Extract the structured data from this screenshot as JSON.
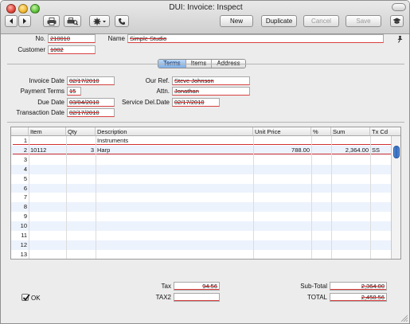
{
  "window": {
    "title": "DUI: Invoice: Inspect"
  },
  "toolbar": {
    "new_label": "New",
    "duplicate_label": "Duplicate",
    "cancel_label": "Cancel",
    "save_label": "Save"
  },
  "header": {
    "no_label": "No.",
    "no_value": "210010",
    "name_label": "Name",
    "name_value": "Simple Studio",
    "customer_label": "Customer",
    "customer_value": "1002"
  },
  "tabs": [
    {
      "label": "Terms",
      "active": true
    },
    {
      "label": "Items",
      "active": false
    },
    {
      "label": "Address",
      "active": false
    }
  ],
  "terms": {
    "invoice_date_label": "Invoice Date",
    "invoice_date": "02/17/2010",
    "payment_terms_label": "Payment Terms",
    "payment_terms": "15",
    "due_date_label": "Due Date",
    "due_date": "03/04/2010",
    "transaction_date_label": "Transaction Date",
    "transaction_date": "02/17/2010",
    "our_ref_label": "Our Ref.",
    "our_ref": "Steve Johnson",
    "attn_label": "Attn.",
    "attn": "Jonathan",
    "service_del_date_label": "Service Del.Date",
    "service_del_date": "02/17/2010"
  },
  "grid": {
    "columns": [
      "Item",
      "Qty",
      "Description",
      "Unit Price",
      "%",
      "Sum",
      "Tx Cd"
    ],
    "rows": [
      {
        "n": "1",
        "item": "",
        "qty": "",
        "desc": "Instruments",
        "price": "",
        "pct": "",
        "sum": "",
        "tx": ""
      },
      {
        "n": "2",
        "item": "10112",
        "qty": "3",
        "desc": "Harp",
        "price": "788.00",
        "pct": "",
        "sum": "2,364.00",
        "tx": "SS"
      },
      {
        "n": "3"
      },
      {
        "n": "4"
      },
      {
        "n": "5"
      },
      {
        "n": "6"
      },
      {
        "n": "7"
      },
      {
        "n": "8"
      },
      {
        "n": "9"
      },
      {
        "n": "10"
      },
      {
        "n": "11"
      },
      {
        "n": "12"
      },
      {
        "n": "13"
      }
    ]
  },
  "footer": {
    "tax_label": "Tax",
    "tax_value": "94.56",
    "tax2_label": "TAX2",
    "tax2_value": "",
    "subtotal_label": "Sub-Total",
    "subtotal_value": "2,364.00",
    "total_label": "TOTAL",
    "total_value": "2,458.56",
    "ok_label": "OK",
    "ok_checked": true
  },
  "colors": {
    "accent": "#5a8fd8",
    "strike": "#d03030",
    "row_alt": "#edf3fd"
  }
}
